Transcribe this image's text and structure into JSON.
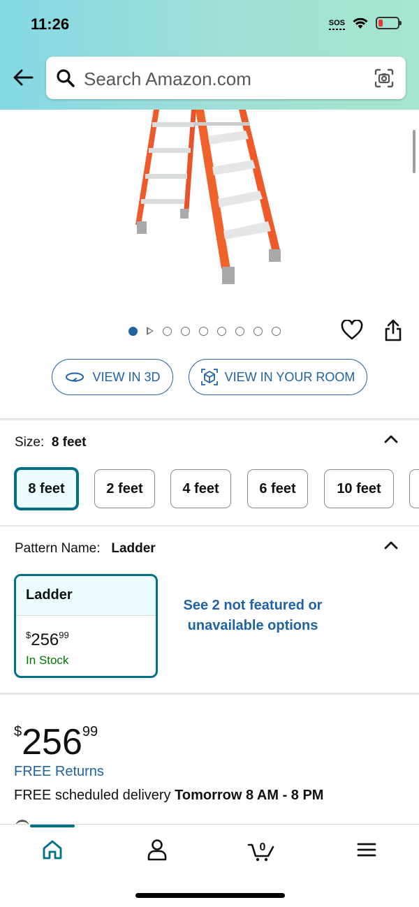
{
  "status_bar": {
    "time": "11:26",
    "sos": "SOS"
  },
  "search": {
    "placeholder": "Search Amazon.com"
  },
  "carousel": {
    "total": 9,
    "active_index": 0
  },
  "view_buttons": {
    "view_3d": "VIEW IN 3D",
    "view_room": "VIEW IN YOUR ROOM"
  },
  "size": {
    "label": "Size:",
    "selected": "8 feet",
    "options": [
      "8 feet",
      "2 feet",
      "4 feet",
      "6 feet",
      "10 feet"
    ]
  },
  "pattern": {
    "label": "Pattern Name:",
    "selected": "Ladder",
    "card": {
      "name": "Ladder",
      "price_whole": "256",
      "price_fraction": "99",
      "currency": "$",
      "stock": "In Stock"
    },
    "see_more": "See 2 not featured or unavailable options"
  },
  "price": {
    "currency": "$",
    "whole": "256",
    "fraction": "99"
  },
  "shipping": {
    "free_returns": "FREE Returns",
    "delivery_prefix": "FREE scheduled delivery",
    "delivery_time": "Tomorrow 8 AM - 8 PM"
  },
  "bottom_nav": {
    "cart_count": "0",
    "items": [
      "home",
      "account",
      "cart",
      "menu"
    ]
  },
  "colors": {
    "accent": "#007185",
    "link": "#2162a1",
    "stock": "#007600",
    "ladder": "#ee5a2a"
  }
}
